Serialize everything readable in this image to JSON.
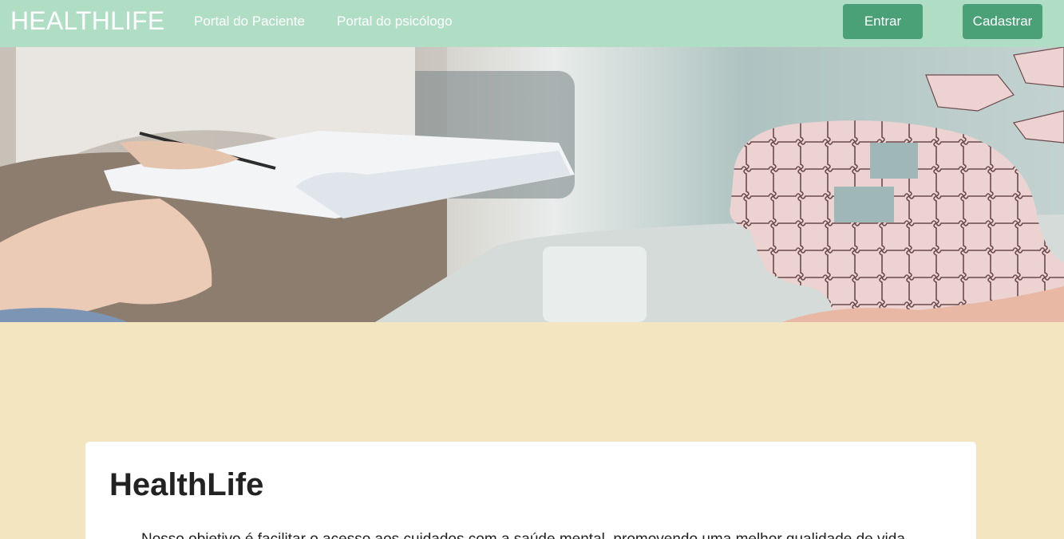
{
  "header": {
    "brand": "HEALTHLIFE",
    "links": [
      "Portal do Paciente",
      "Portal do psicólogo"
    ],
    "login_label": "Entrar",
    "signup_label": "Cadastrar"
  },
  "card": {
    "title": "HealthLife",
    "text": "Nosso objetivo é facilitar o acesso aos cuidados com a saúde mental, promovendo uma melhor qualidade de vida"
  },
  "colors": {
    "navbar": "#b0dec5",
    "button": "#4aa077",
    "page_background": "#f3e5c0"
  }
}
